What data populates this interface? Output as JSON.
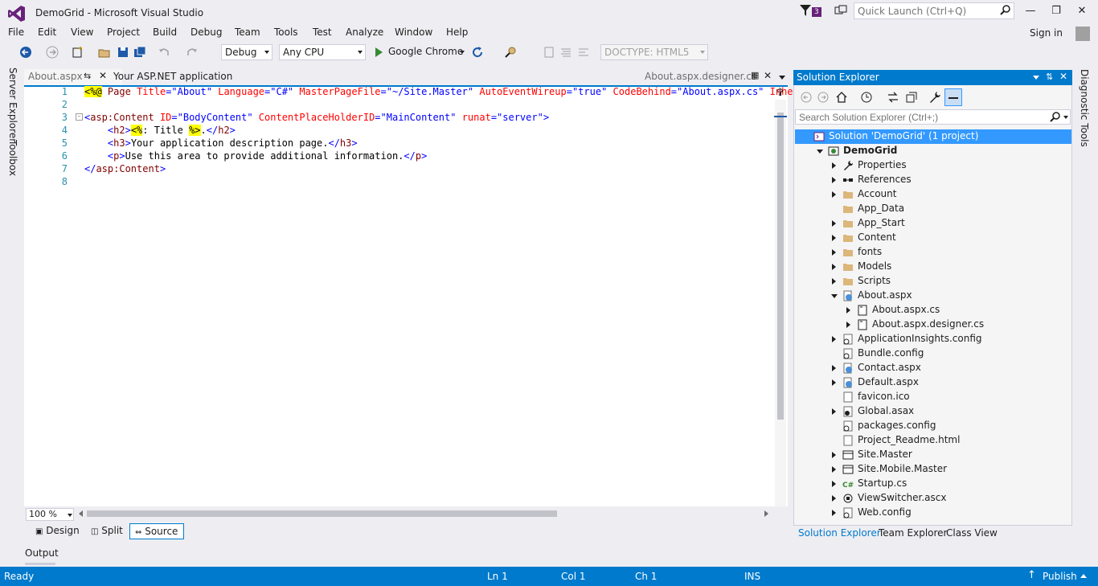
{
  "window": {
    "title": "DemoGrid - Microsoft Visual Studio",
    "notification_count": "3",
    "quick_launch_placeholder": "Quick Launch (Ctrl+Q)",
    "sign_in_label": "Sign in"
  },
  "menu": [
    "File",
    "Edit",
    "View",
    "Project",
    "Build",
    "Debug",
    "Team",
    "Tools",
    "Test",
    "Analyze",
    "Window",
    "Help"
  ],
  "toolbar": {
    "config": "Debug",
    "platform": "Any CPU",
    "browser": "Google Chrome",
    "doctype": "DOCTYPE: HTML5"
  },
  "side_tabs": {
    "server_explorer": "Server Explorer",
    "toolbox": "Toolbox",
    "diagnostic_tools": "Diagnostic Tools"
  },
  "doc_tabs": {
    "active": "About.aspx",
    "secondary": "Your ASP.NET application",
    "preview": "About.aspx.designer.cs"
  },
  "editor": {
    "line_numbers": [
      "1",
      "2",
      "3",
      "4",
      "5",
      "6",
      "7",
      "8"
    ],
    "zoom": "100 %"
  },
  "view_tabs": {
    "design": "Design",
    "split": "Split",
    "source": "Source"
  },
  "output_label": "Output",
  "solution_explorer": {
    "title": "Solution Explorer",
    "search_placeholder": "Search Solution Explorer (Ctrl+;)",
    "tree": [
      {
        "label": "Solution 'DemoGrid' (1 project)",
        "depth": 0,
        "icon": "solution-icon",
        "expander": "none",
        "selected": true
      },
      {
        "label": "DemoGrid",
        "depth": 1,
        "icon": "project-icon",
        "expander": "down",
        "bold": true
      },
      {
        "label": "Properties",
        "depth": 2,
        "icon": "wrench-icon",
        "expander": "right"
      },
      {
        "label": "References",
        "depth": 2,
        "icon": "references-icon",
        "expander": "right"
      },
      {
        "label": "Account",
        "depth": 2,
        "icon": "folder-icon",
        "expander": "right"
      },
      {
        "label": "App_Data",
        "depth": 2,
        "icon": "folder-icon",
        "expander": "none"
      },
      {
        "label": "App_Start",
        "depth": 2,
        "icon": "folder-icon",
        "expander": "right"
      },
      {
        "label": "Content",
        "depth": 2,
        "icon": "folder-icon",
        "expander": "right"
      },
      {
        "label": "fonts",
        "depth": 2,
        "icon": "folder-icon",
        "expander": "right"
      },
      {
        "label": "Models",
        "depth": 2,
        "icon": "folder-icon",
        "expander": "right"
      },
      {
        "label": "Scripts",
        "depth": 2,
        "icon": "folder-icon",
        "expander": "right"
      },
      {
        "label": "About.aspx",
        "depth": 2,
        "icon": "web-page-icon",
        "expander": "down"
      },
      {
        "label": "About.aspx.cs",
        "depth": 3,
        "icon": "code-file-icon",
        "expander": "right"
      },
      {
        "label": "About.aspx.designer.cs",
        "depth": 3,
        "icon": "code-file-icon",
        "expander": "right"
      },
      {
        "label": "ApplicationInsights.config",
        "depth": 2,
        "icon": "config-icon",
        "expander": "right"
      },
      {
        "label": "Bundle.config",
        "depth": 2,
        "icon": "config-icon",
        "expander": "none"
      },
      {
        "label": "Contact.aspx",
        "depth": 2,
        "icon": "web-page-icon",
        "expander": "right"
      },
      {
        "label": "Default.aspx",
        "depth": 2,
        "icon": "web-page-icon",
        "expander": "right"
      },
      {
        "label": "favicon.ico",
        "depth": 2,
        "icon": "image-file-icon",
        "expander": "none"
      },
      {
        "label": "Global.asax",
        "depth": 2,
        "icon": "global-icon",
        "expander": "right"
      },
      {
        "label": "packages.config",
        "depth": 2,
        "icon": "config-icon",
        "expander": "none"
      },
      {
        "label": "Project_Readme.html",
        "depth": 2,
        "icon": "html-file-icon",
        "expander": "none"
      },
      {
        "label": "Site.Master",
        "depth": 2,
        "icon": "master-page-icon",
        "expander": "right"
      },
      {
        "label": "Site.Mobile.Master",
        "depth": 2,
        "icon": "master-page-icon",
        "expander": "right"
      },
      {
        "label": "Startup.cs",
        "depth": 2,
        "icon": "csharp-icon",
        "expander": "right"
      },
      {
        "label": "ViewSwitcher.ascx",
        "depth": 2,
        "icon": "user-control-icon",
        "expander": "right"
      },
      {
        "label": "Web.config",
        "depth": 2,
        "icon": "config-icon",
        "expander": "right"
      }
    ],
    "bottom_tabs": [
      "Solution Explorer",
      "Team Explorer",
      "Class View"
    ]
  },
  "status": {
    "ready": "Ready",
    "line": "Ln 1",
    "col": "Col 1",
    "ch": "Ch 1",
    "mode": "INS",
    "publish": "Publish"
  },
  "colors": {
    "accent": "#007acc",
    "selection": "#3399ff",
    "badge": "#68217a"
  }
}
